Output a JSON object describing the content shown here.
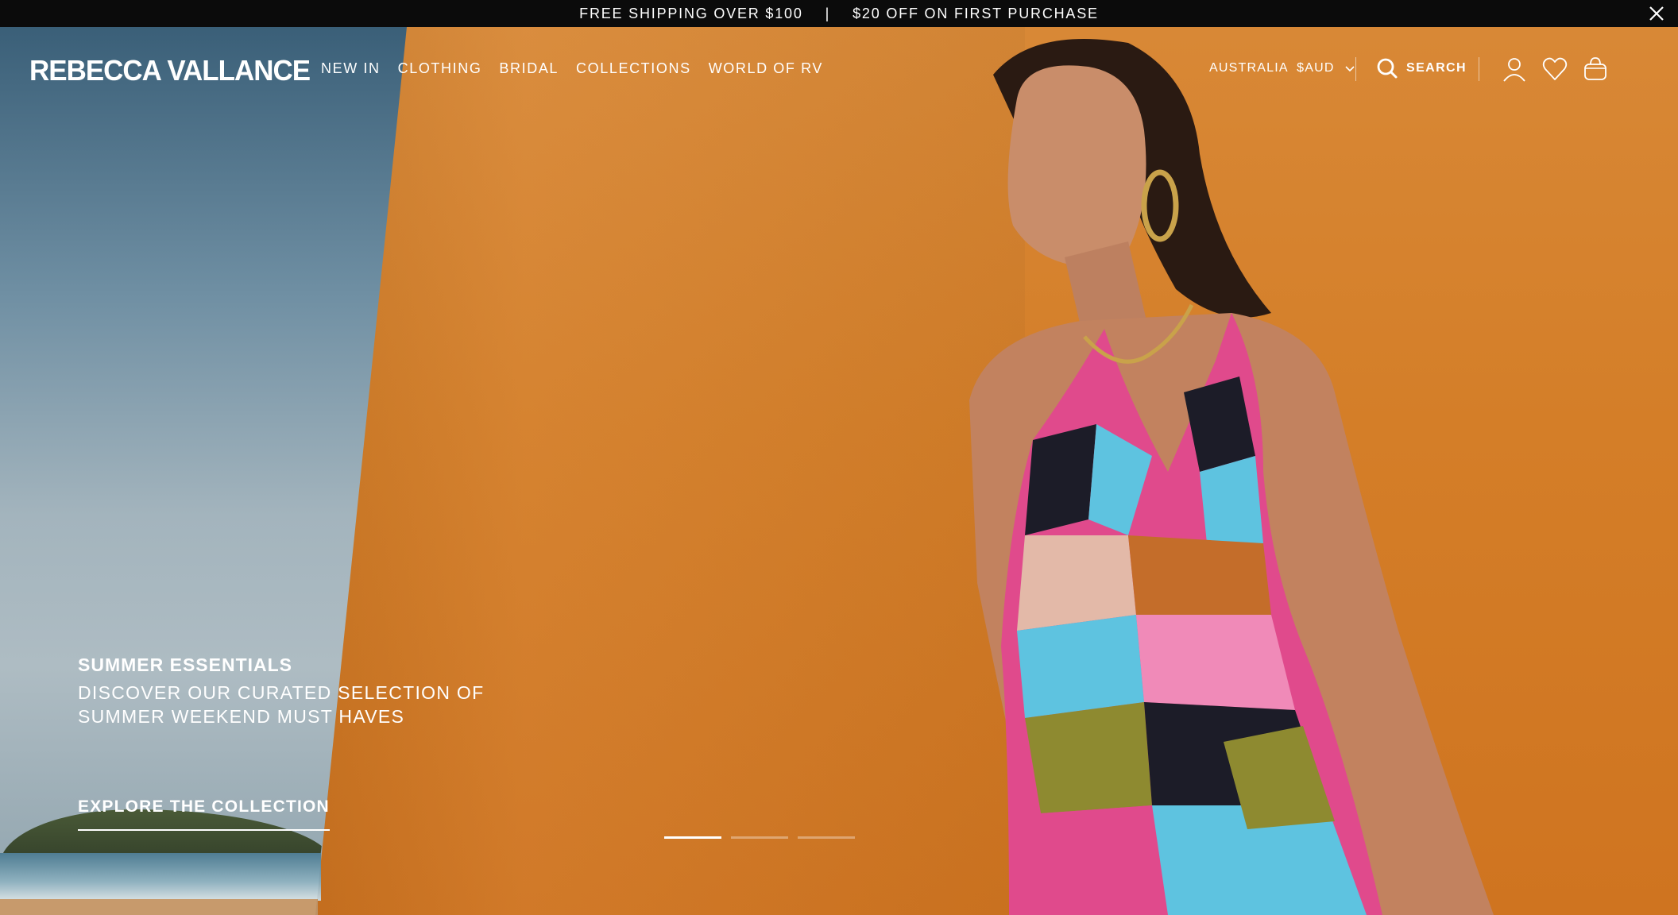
{
  "promo": {
    "shipping": "FREE SHIPPING OVER $100",
    "separator": "|",
    "discount": "$20 OFF ON FIRST PURCHASE"
  },
  "header": {
    "logo": "REBECCA VALLANCE",
    "nav": [
      {
        "label": "NEW IN"
      },
      {
        "label": "CLOTHING"
      },
      {
        "label": "BRIDAL"
      },
      {
        "label": "COLLECTIONS"
      },
      {
        "label": "WORLD OF RV"
      }
    ],
    "region": "AUSTRALIA  $AUD",
    "search_label": "SEARCH"
  },
  "hero": {
    "title": "SUMMER ESSENTIALS",
    "subtitle": "DISCOVER OUR CURATED SELECTION OF SUMMER WEEKEND MUST HAVES",
    "cta": "EXPLORE THE COLLECTION",
    "slides": 3,
    "active_slide": 1
  },
  "icons": {
    "close": "close-icon",
    "search": "search-icon",
    "account": "user-icon",
    "wishlist": "heart-icon",
    "cart": "bag-icon",
    "region": "chevron-down-icon"
  },
  "colors": {
    "promo_bg": "#0b0b0b",
    "hero_orange": "#d47e28",
    "text": "#ffffff"
  }
}
